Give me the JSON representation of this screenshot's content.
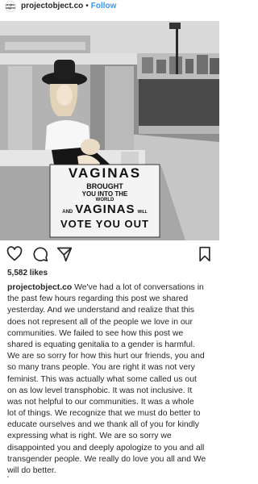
{
  "header": {
    "avatar_text": "project object",
    "username": "projectobject.co",
    "separator": "•",
    "follow_label": "Follow"
  },
  "post": {
    "sign_lines": [
      "VAGINAS",
      "BROUGHT",
      "YOU INTO THE",
      "WORLD",
      "AND",
      "VAGINAS",
      "WILL",
      "VOTE YOU OUT"
    ],
    "likes": "5,582 likes"
  },
  "actions": {
    "like_icon": "heart-icon",
    "comment_icon": "comment-icon",
    "share_icon": "send-icon",
    "save_icon": "bookmark-icon"
  },
  "caption": {
    "username": "projectobject.co",
    "lines": [
      " We've had a lot of conversations in",
      "the past few hours regarding this post we shared",
      "yesterday. And we understand and realize that this",
      "does not represent all of the people we love in our",
      "communities. We failed to see how this post we",
      "shared is equating genitalia to a gender is harmful.",
      "We are so sorry for how this hurt our friends, you and",
      "so many trans people. You are right it was not very",
      "feminist. This was actually what some called us out",
      "on as low level transphobic. It was not inclusive. It",
      "was not helpful to our communities. It was a whole",
      "lot of things. We recognize that we must do better to",
      "educate ourselves and we thank all of you for kindly",
      "expressing what is right. We are so sorry we",
      "disappointed you and deeply apologize to you and all",
      "transgender people. We really do love you all and We",
      "will do better."
    ]
  }
}
